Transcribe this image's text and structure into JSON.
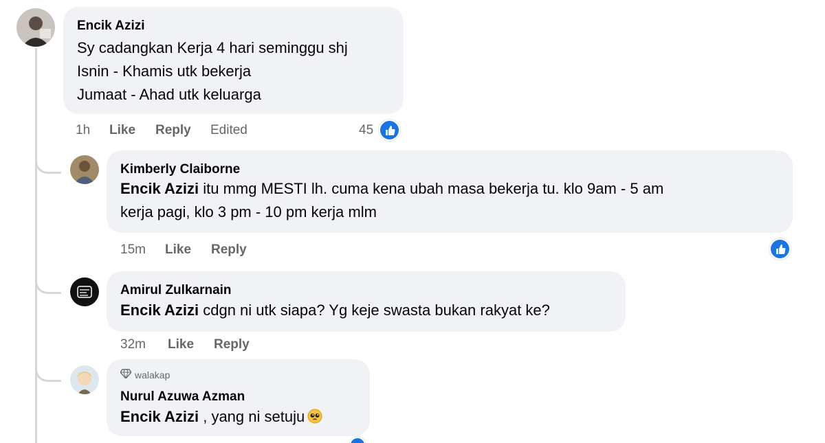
{
  "colors": {
    "bubble": "#f0f2f5",
    "meta_text": "#65676b",
    "like_blue": "#1b74e4",
    "thread_line": "#d4d6da"
  },
  "comments": [
    {
      "author": "Encik Azizi",
      "lines": [
        "Sy cadangkan Kerja 4 hari seminggu shj",
        "Isnin - Khamis utk bekerja",
        "Jumaat - Ahad utk keluarga"
      ],
      "time": "1h",
      "like": "Like",
      "reply": "Reply",
      "edited": "Edited",
      "reactions": "45",
      "reaction_icon": "like-icon"
    },
    {
      "author": "Kimberly Claiborne",
      "mention": "Encik Azizi",
      "lines": [
        " itu mmg MESTI lh. cuma kena ubah masa bekerja tu. klo 9am - 5 am",
        "kerja pagi, klo 3 pm - 10 pm kerja mlm"
      ],
      "time": "15m",
      "like": "Like",
      "reply": "Reply",
      "reaction_icon": "like-icon"
    },
    {
      "author": "Amirul Zulkarnain",
      "mention": "Encik Azizi",
      "lines": [
        " cdgn ni utk siapa? Yg keje swasta bukan rakyat ke?"
      ],
      "time": "32m",
      "like": "Like",
      "reply": "Reply"
    },
    {
      "badge": "walakap",
      "badge_icon": "diamond-icon",
      "author": "Nurul Azuwa Azman",
      "mention": "Encik Azizi",
      "lines": [
        " , yang ni setuju"
      ],
      "emoji": "pleading-face-emoji"
    }
  ]
}
